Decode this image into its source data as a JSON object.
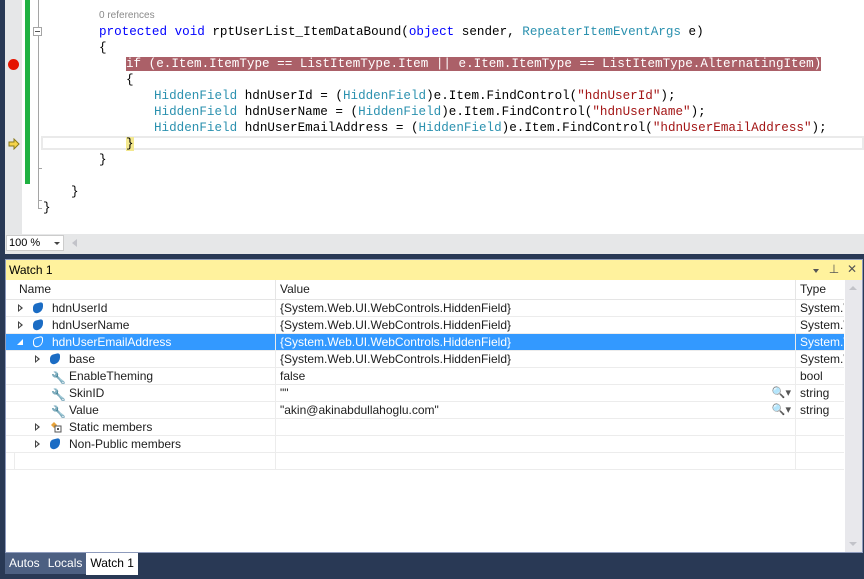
{
  "editor": {
    "codelens": "0 references",
    "lines": {
      "l1_kw": "protected void ",
      "l1_name": "rptUserList_ItemDataBound(",
      "l1_kw2": "object",
      "l1_mid": " sender, ",
      "l1_type": "RepeaterItemEventArgs",
      "l1_end": " e)",
      "brace_open": "{",
      "if_line": "if (e.Item.ItemType == ListItemType.Item || e.Item.ItemType == ListItemType.AlternatingItem)",
      "inner_open": "{",
      "decl1": {
        "type": "HiddenField",
        "var": " hdnUserId = (",
        "cast": "HiddenField",
        "call": ")e.Item.FindControl(",
        "arg": "\"hdnUserId\"",
        "end": ");"
      },
      "decl2": {
        "type": "HiddenField",
        "var": " hdnUserName = (",
        "cast": "HiddenField",
        "call": ")e.Item.FindControl(",
        "arg": "\"hdnUserName\"",
        "end": ");"
      },
      "decl3": {
        "type": "HiddenField",
        "var": " hdnUserEmailAddress = (",
        "cast": "HiddenField",
        "call": ")e.Item.FindControl(",
        "arg": "\"hdnUserEmailAddress\"",
        "end": ");"
      },
      "inner_close": "}",
      "method_close": "}",
      "class_close": "}",
      "ns_close": "}"
    },
    "zoom_level": "100 %"
  },
  "watch": {
    "title": "Watch 1",
    "columns": {
      "name": "Name",
      "value": "Value",
      "type": "Type"
    },
    "rows": [
      {
        "name": "hdnUserId",
        "value": "{System.Web.UI.WebControls.HiddenField}",
        "type": "System.W"
      },
      {
        "name": "hdnUserName",
        "value": "{System.Web.UI.WebControls.HiddenField}",
        "type": "System.W"
      },
      {
        "name": "hdnUserEmailAddress",
        "value": "{System.Web.UI.WebControls.HiddenField}",
        "type": "System.W"
      },
      {
        "name": "base",
        "value": "{System.Web.UI.WebControls.HiddenField}",
        "type": "System.W"
      },
      {
        "name": "EnableTheming",
        "value": "false",
        "type": "bool"
      },
      {
        "name": "SkinID",
        "value": "\"\"",
        "type": "string"
      },
      {
        "name": "Value",
        "value": "\"akin@akinabdullahoglu.com\"",
        "type": "string"
      },
      {
        "name": "Static members",
        "value": "",
        "type": ""
      },
      {
        "name": "Non-Public members",
        "value": "",
        "type": ""
      }
    ],
    "title_buttons": {
      "dropdown": "▾",
      "pin": "⊥",
      "close": "✕"
    },
    "magnifier": "🔍▾"
  },
  "tabs": [
    {
      "label": "Autos"
    },
    {
      "label": "Locals"
    },
    {
      "label": "Watch 1",
      "active": true
    }
  ],
  "colors": {
    "breakpoint": "#e51400",
    "breakpoint_highlight": "#ab6068",
    "selection": "#3399ff",
    "title_bar": "#fff29d",
    "frame": "#293955"
  }
}
